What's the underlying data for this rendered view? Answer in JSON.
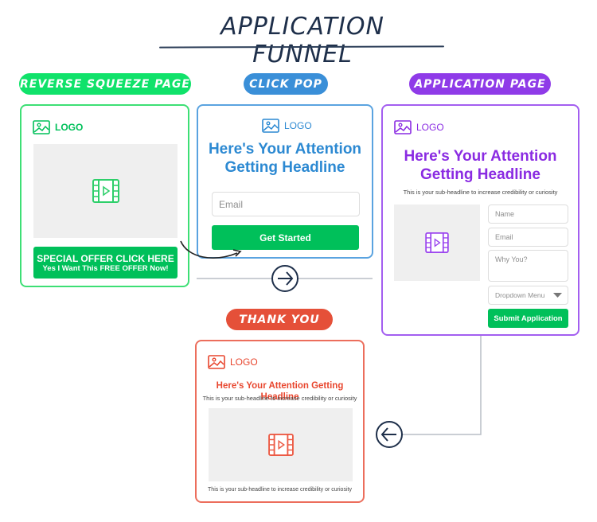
{
  "title": "APPLICATION FUNNEL",
  "colors": {
    "green": "#00c05a",
    "green_border": "#3ddf75",
    "green_pill": "#10e26a",
    "blue": "#2c89d2",
    "blue_pill": "#3a8fd8",
    "purple": "#8a2be2",
    "purple_pill": "#8f3be8",
    "red": "#e8462e",
    "red_pill": "#e55039",
    "connector": "#1e2f4a",
    "line_gray": "#b8bec6"
  },
  "stages": {
    "reverse_squeeze": {
      "label": "REVERSE SQUEEZE PAGE",
      "logo": "LOGO",
      "logo_icon": "image-icon",
      "video_icon": "video-icon",
      "button_line1": "SPECIAL OFFER CLICK HERE",
      "button_line2": "Yes I Want This FREE OFFER Now!"
    },
    "click_pop": {
      "label": "CLICK POP",
      "logo": "LOGO",
      "logo_icon": "image-icon",
      "headline_line1": "Here's Your Attention",
      "headline_line2": "Getting Headline",
      "email_placeholder": "Email",
      "button": "Get Started"
    },
    "application_page": {
      "label": "APPLICATION PAGE",
      "logo": "LOGO",
      "logo_icon": "image-icon",
      "headline_line1": "Here's Your Attention",
      "headline_line2": "Getting Headline",
      "subheadline": "This is your sub-headline to increase credibility or curiosity",
      "video_icon": "video-icon",
      "name_placeholder": "Name",
      "email_placeholder": "Email",
      "why_placeholder": "Why You?",
      "dropdown": "Dropdown Menu",
      "button": "Submit Application"
    },
    "thank_you": {
      "label": "THANK YOU",
      "logo": "LOGO",
      "logo_icon": "image-icon",
      "headline": "Here's Your Attention Getting Headline",
      "subheadline": "This is your sub-headline to increase credibility or curiosity",
      "video_icon": "video-icon",
      "footer_text": "This is your sub-headline to increase credibility or curiosity"
    }
  },
  "connectors": [
    {
      "from": "reverse_squeeze",
      "to": "click_pop",
      "type": "curved-arrow"
    },
    {
      "from": "click_pop",
      "to": "application_page",
      "type": "arrow-right-circle"
    },
    {
      "from": "application_page",
      "to": "thank_you",
      "type": "arrow-left-circle"
    }
  ]
}
